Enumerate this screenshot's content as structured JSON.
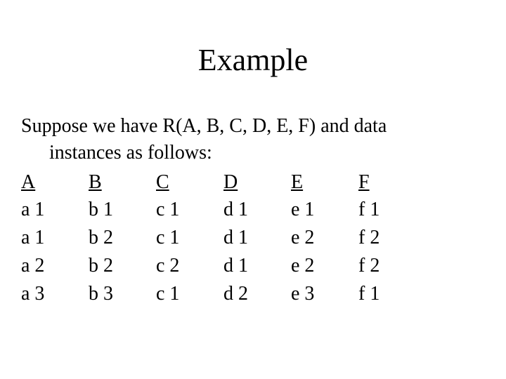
{
  "title": "Example",
  "intro": {
    "line1": "Suppose we have R(A, B, C, D, E, F) and data",
    "line2": "instances as follows:"
  },
  "table": {
    "headers": [
      "A",
      "B",
      "C",
      "D",
      "E",
      "F"
    ],
    "rows": [
      [
        "a 1",
        "b 1",
        "c 1",
        "d 1",
        "e 1",
        "f 1"
      ],
      [
        "a 1",
        "b 2",
        "c 1",
        "d 1",
        "e 2",
        "f 2"
      ],
      [
        "a 2",
        "b 2",
        "c 2",
        "d 1",
        "e 2",
        "f 2"
      ],
      [
        "a 3",
        "b 3",
        "c 1",
        "d 2",
        "e 3",
        "f 1"
      ]
    ]
  }
}
